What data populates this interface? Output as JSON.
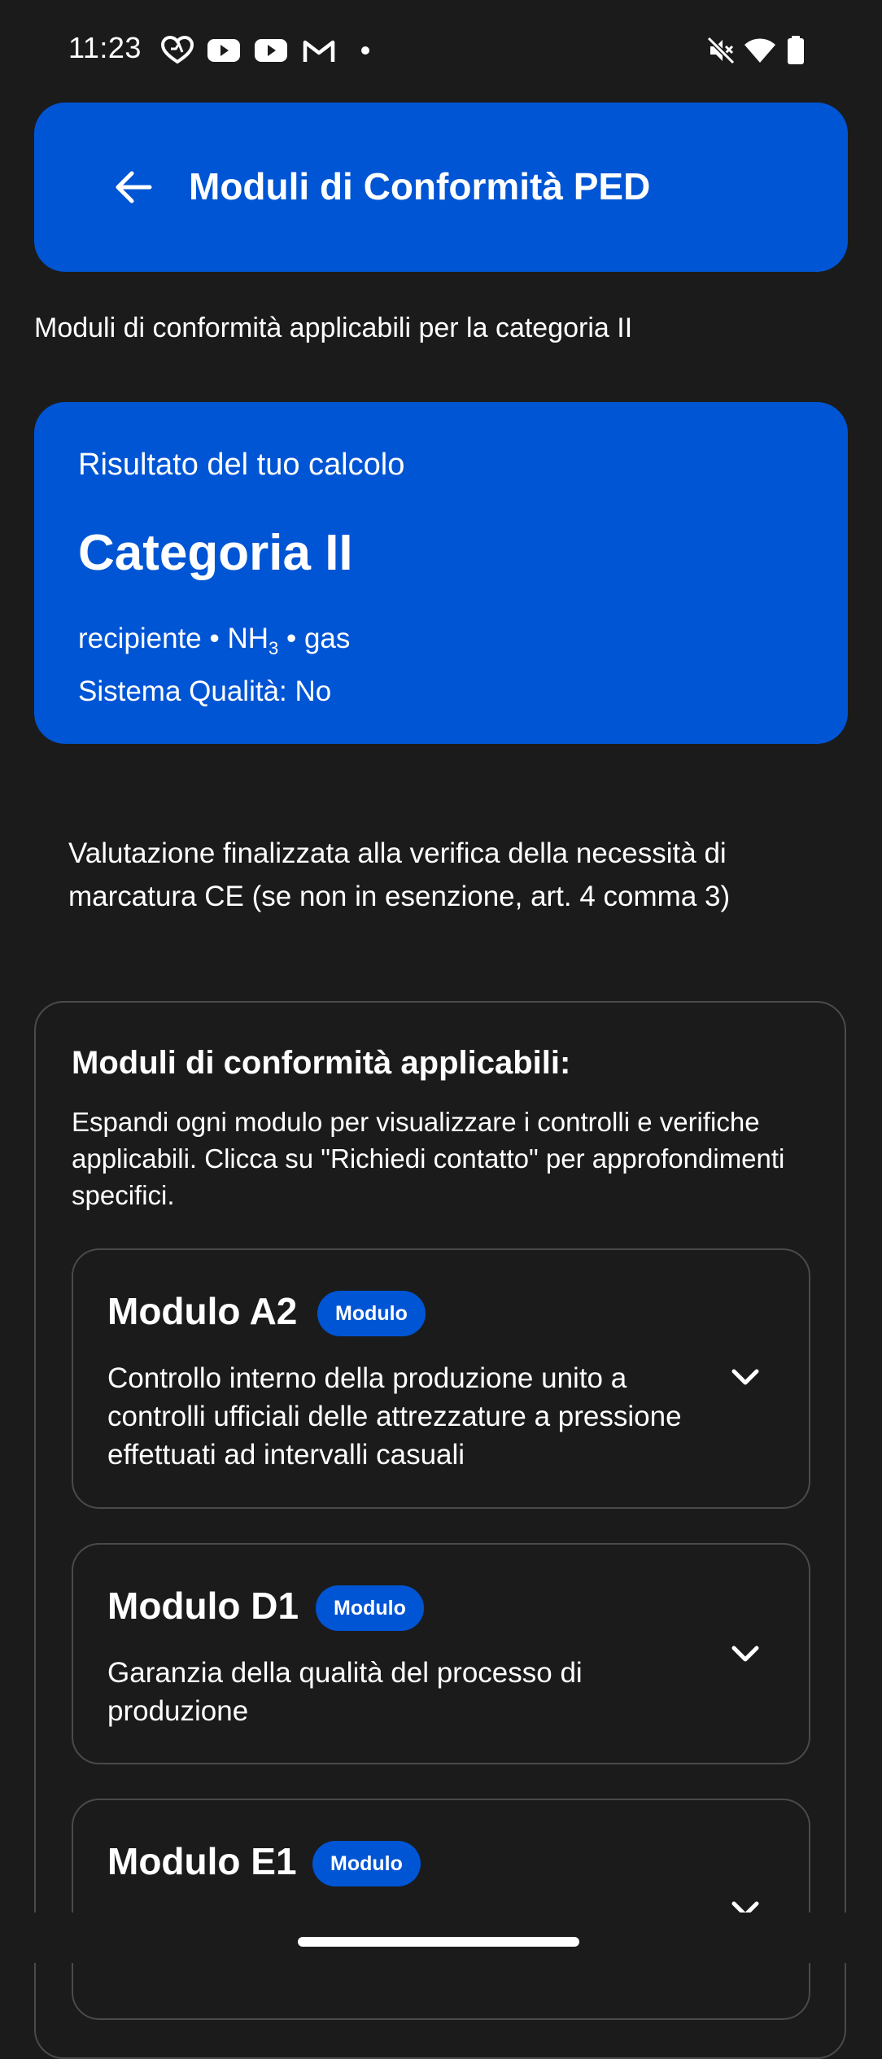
{
  "status_bar": {
    "time": "11:23"
  },
  "app_bar": {
    "title": "Moduli di Conformità PED"
  },
  "subtitle": "Moduli di conformità applicabili per la categoria II",
  "result": {
    "label": "Risultato del tuo calcolo",
    "category": "Categoria II",
    "type_line_prefix": "recipiente • NH",
    "type_line_sub": "3",
    "type_line_suffix": " • gas",
    "quality_line": "Sistema Qualità: No"
  },
  "note": "Valutazione finalizzata alla verifica della necessità di marcatura CE (se non in esenzione, art. 4 comma 3)",
  "modules_section": {
    "title": "Moduli di conformità applicabili:",
    "description": "Espandi ogni modulo per visualizzare i controlli e verifiche applicabili. Clicca su \"Richiedi contatto\" per approfondimenti specifici.",
    "modules": [
      {
        "name": "Modulo A2",
        "badge": "Modulo",
        "description": "Controllo interno della produzione unito a controlli ufficiali delle attrezzature a pressione effettuati ad intervalli casuali"
      },
      {
        "name": "Modulo D1",
        "badge": "Modulo",
        "description": "Garanzia della qualità del processo di produzione"
      },
      {
        "name": "Modulo E1",
        "badge": "Modulo",
        "description": ""
      }
    ]
  },
  "colors": {
    "background": "#1b1b1b",
    "accent": "#0055d4",
    "border": "#4a4a4a",
    "text": "#ffffff"
  }
}
